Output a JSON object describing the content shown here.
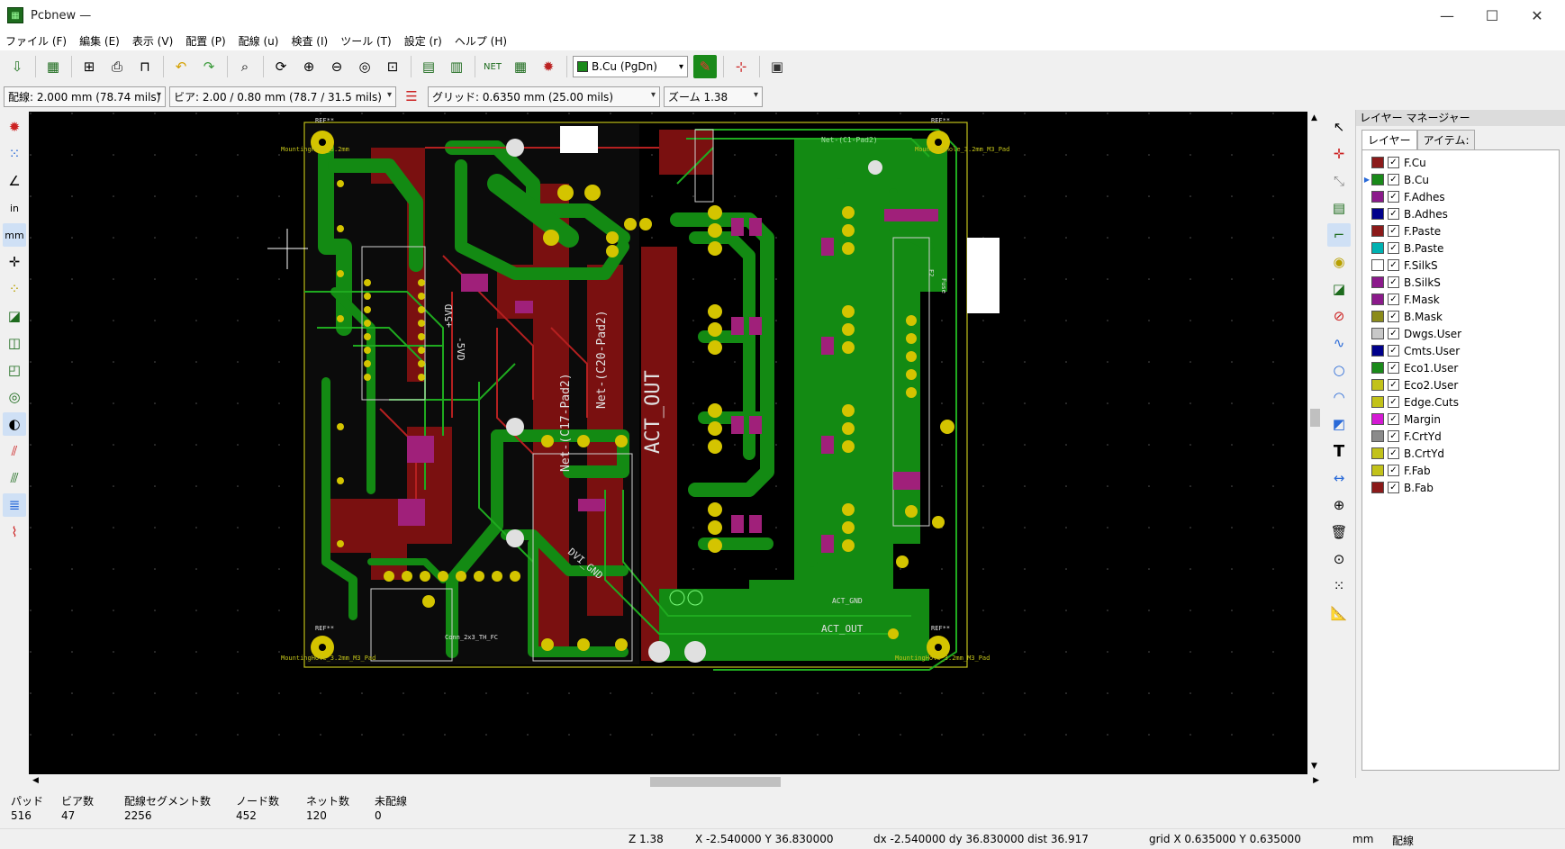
{
  "window": {
    "title": "Pcbnew —",
    "min": "—",
    "max": "☐",
    "close": "✕"
  },
  "menu": [
    "ファイル (F)",
    "編集 (E)",
    "表示 (V)",
    "配置 (P)",
    "配線 (u)",
    "検査 (I)",
    "ツール (T)",
    "設定 (r)",
    "ヘルプ (H)"
  ],
  "toolbar": {
    "active_layer": "B.Cu (PgDn)",
    "track_width": "配線: 2.000 mm (78.74 mils)",
    "via_size": "ビア: 2.00 / 0.80 mm (78.7 / 31.5 mils)",
    "grid": "グリッド: 0.6350 mm (25.00 mils)",
    "zoom": "ズーム 1.38"
  },
  "left_tools": [
    "drc-marker",
    "grid",
    "polar",
    "in",
    "mm",
    "cursor",
    "ratsnest",
    "zone-fill",
    "zone-outline",
    "zone-no",
    "via",
    "high-contrast",
    "track-outline",
    "pad-outline",
    "layers",
    "microwave"
  ],
  "left_labels": {
    "in": "in",
    "mm": "mm"
  },
  "right_tools": [
    "select",
    "footprint",
    "route-track",
    "diff-pair",
    "add-via",
    "zone",
    "keepout",
    "line",
    "circle",
    "arc",
    "polygon",
    "text",
    "dimension",
    "target",
    "delete",
    "drill-origin",
    "grid-origin",
    "measure"
  ],
  "layer_manager": {
    "title": "レイヤー マネージャー",
    "tabs": [
      "レイヤー",
      "アイテム:"
    ],
    "layers": [
      {
        "name": "F.Cu",
        "color": "#8b1a1a"
      },
      {
        "name": "B.Cu",
        "color": "#1a8a1a",
        "current": true
      },
      {
        "name": "F.Adhes",
        "color": "#8b1a8b"
      },
      {
        "name": "B.Adhes",
        "color": "#00008b"
      },
      {
        "name": "F.Paste",
        "color": "#8b1a1a"
      },
      {
        "name": "B.Paste",
        "color": "#00b2b2"
      },
      {
        "name": "F.SilkS",
        "color": "#ffffff"
      },
      {
        "name": "B.SilkS",
        "color": "#8b1a8b"
      },
      {
        "name": "F.Mask",
        "color": "#8b1a8b"
      },
      {
        "name": "B.Mask",
        "color": "#8b8b1a"
      },
      {
        "name": "Dwgs.User",
        "color": "#c8c8c8"
      },
      {
        "name": "Cmts.User",
        "color": "#00008b"
      },
      {
        "name": "Eco1.User",
        "color": "#1a8a1a"
      },
      {
        "name": "Eco2.User",
        "color": "#c2c21a"
      },
      {
        "name": "Edge.Cuts",
        "color": "#c2c21a"
      },
      {
        "name": "Margin",
        "color": "#d41ad4"
      },
      {
        "name": "F.CrtYd",
        "color": "#8b8b8b"
      },
      {
        "name": "B.CrtYd",
        "color": "#c2c21a"
      },
      {
        "name": "F.Fab",
        "color": "#c2c21a"
      },
      {
        "name": "B.Fab",
        "color": "#8b1a1a"
      }
    ]
  },
  "board_info": {
    "headers": [
      "パッド",
      "ビア数",
      "配線セグメント数",
      "ノード数",
      "ネット数",
      "未配線"
    ],
    "values": [
      "516",
      "47",
      "2256",
      "452",
      "120",
      "0"
    ]
  },
  "statusbar": {
    "zoom": "Z 1.38",
    "xy": "X -2.540000  Y 36.830000",
    "delta": "dx -2.540000  dy 36.830000  dist 36.917",
    "grid": "grid X 0.635000  Y 0.635000",
    "units": "mm",
    "mode": "配線"
  },
  "pcb_labels": {
    "net_c1": "Net-(C1-Pad2)",
    "net_c17": "Net-(C17-Pad2)",
    "net_c20": "Net-(C20-Pad2)",
    "act_out": "ACT_OUT",
    "act_gnd": "ACT_GND",
    "dvi_gnd": "DVI_GND",
    "plus5vd": "+5VD",
    "minus5vd": "-5VD",
    "mh_tl": "MountingHole_3.2mm",
    "mh_tr": "MountingHole_3.2mm_M3_Pad",
    "mh_bl": "MountingHole_3.2mm_M3_Pad",
    "mh_br": "MountingHole_3.2mm_M3_Pad",
    "ref": "REF**",
    "conn": "Conn_2x3_TH_FC",
    "fuse": "Fuse",
    "f2": "F2"
  }
}
